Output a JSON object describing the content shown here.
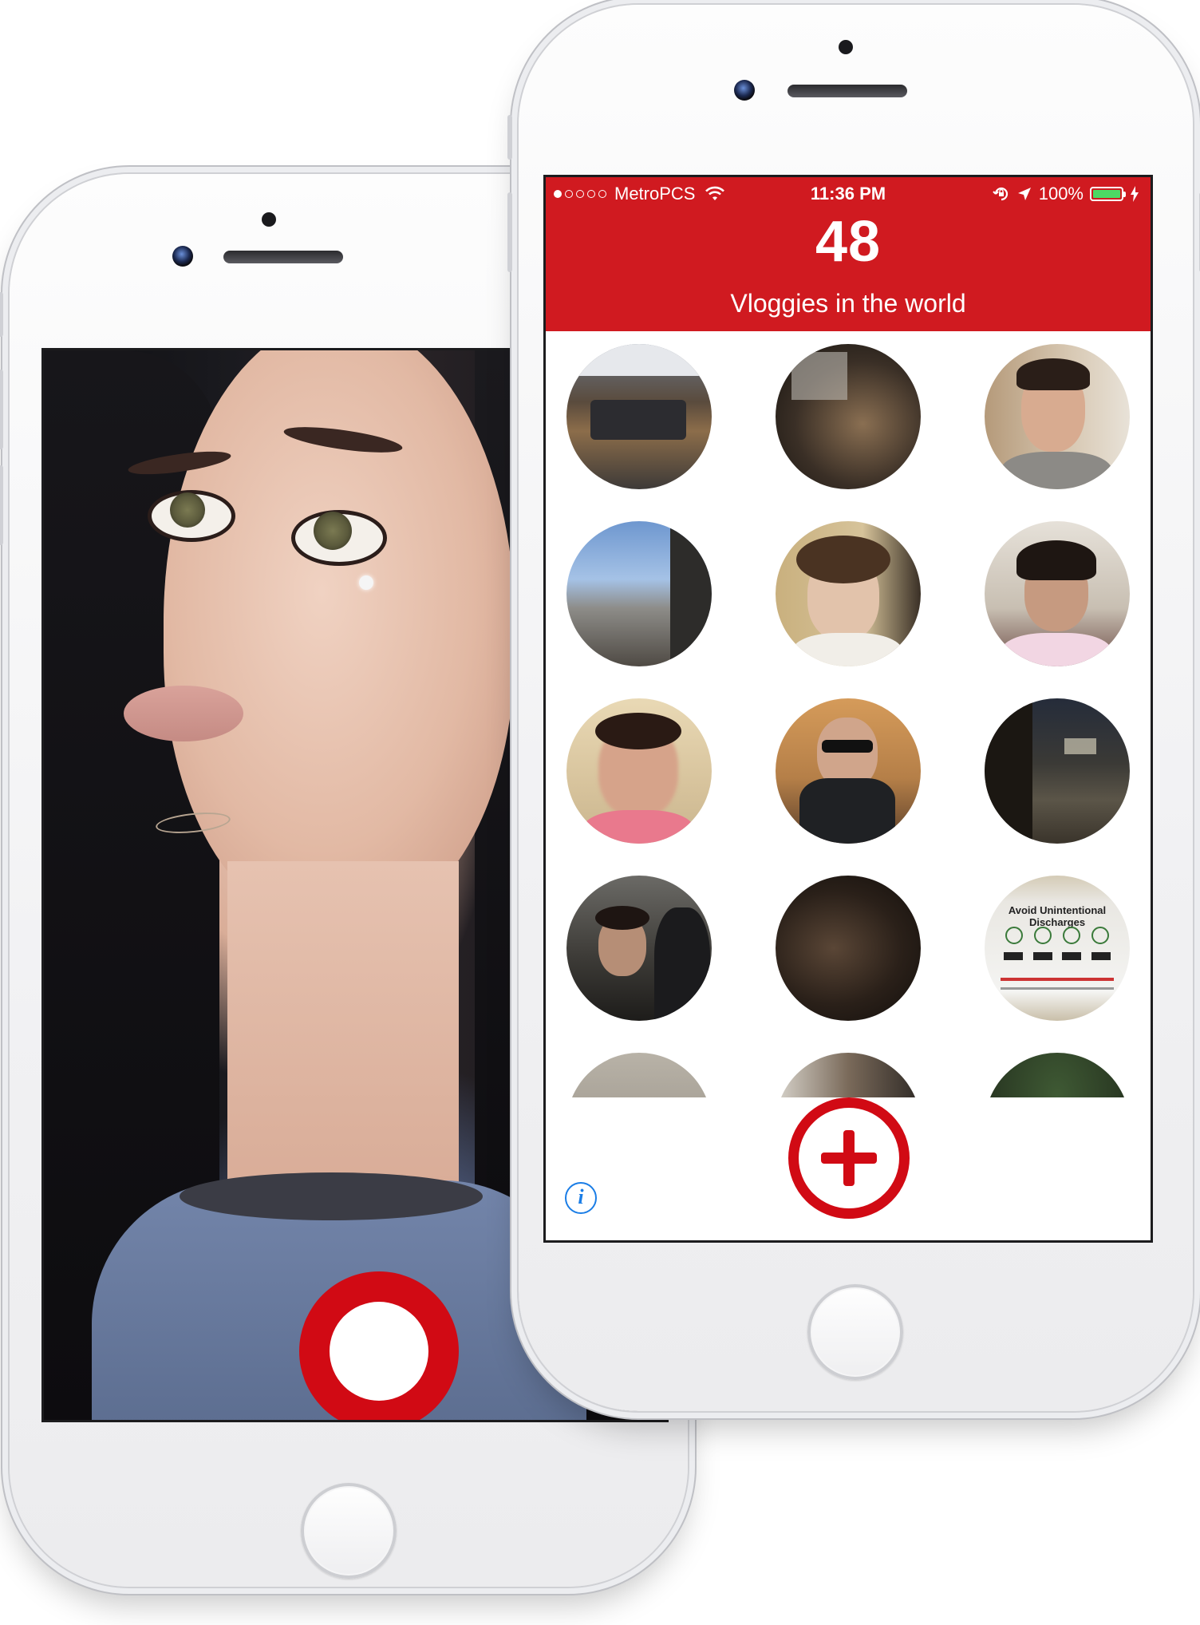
{
  "right_app": {
    "status_bar": {
      "carrier": "MetroPCS",
      "time": "11:36 PM",
      "battery": "100%",
      "signal_bars_filled": 1,
      "signal_bars_total": 5
    },
    "header": {
      "count": "48",
      "subtitle": "Vloggies in the world"
    },
    "thumbnails": [
      {
        "name": "office-room"
      },
      {
        "name": "dark-desk"
      },
      {
        "name": "young-man-portrait"
      },
      {
        "name": "city-window-view"
      },
      {
        "name": "curly-hair-teen"
      },
      {
        "name": "girl-on-couch"
      },
      {
        "name": "blurry-face-pink-shirt"
      },
      {
        "name": "man-sunglasses-hoodie"
      },
      {
        "name": "street-at-night"
      },
      {
        "name": "guy-in-crowd"
      },
      {
        "name": "dark-motion-blur"
      },
      {
        "name": "safety-poster",
        "text": "Avoid Unintentional Discharges"
      },
      {
        "name": "partial-gray"
      },
      {
        "name": "partial-room"
      },
      {
        "name": "partial-tree"
      }
    ],
    "add_button": "plus-icon",
    "info_button": "i"
  },
  "left_app": {
    "record_button": "record-icon"
  },
  "colors": {
    "brand_red": "#d01a20",
    "record_red": "#d10a14",
    "info_blue": "#1a7de6",
    "battery_green": "#4cd964"
  }
}
